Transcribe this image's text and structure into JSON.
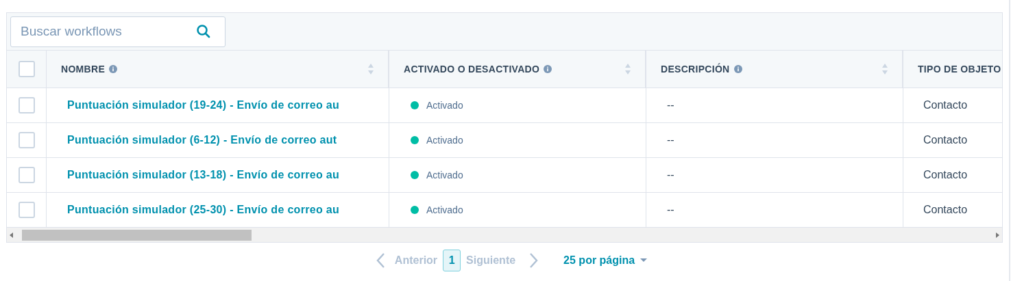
{
  "search": {
    "placeholder": "Buscar workflows"
  },
  "table": {
    "select_all": {
      "checked": false
    },
    "columns": [
      {
        "label": "NOMBRE",
        "info": true,
        "sortable": true
      },
      {
        "label": "ACTIVADO O DESACTIVADO",
        "info": true,
        "sortable": true
      },
      {
        "label": "DESCRIPCIÓN",
        "info": true,
        "sortable": true
      },
      {
        "label": "TIPO DE OBJETO"
      }
    ],
    "rows": [
      {
        "checked": false,
        "name": "Puntuación simulador (19-24) - Envío de correo au",
        "status": "Activado",
        "color": "#00bda5",
        "description": "--",
        "object_type": "Contacto"
      },
      {
        "checked": false,
        "name": "Puntuación simulador (6-12) - Envío de correo aut",
        "status": "Activado",
        "color": "#00bda5",
        "description": "--",
        "object_type": "Contacto"
      },
      {
        "checked": false,
        "name": "Puntuación simulador (13-18) - Envío de correo au",
        "status": "Activado",
        "color": "#00bda5",
        "description": "--",
        "object_type": "Contacto"
      },
      {
        "checked": false,
        "name": "Puntuación simulador (25-30) - Envío de correo au",
        "status": "Activado",
        "color": "#00bda5",
        "description": "--",
        "object_type": "Contacto"
      }
    ]
  },
  "pagination": {
    "previous": "Anterior",
    "pages": [
      {
        "label": "1",
        "selected": true
      }
    ],
    "next": "Siguiente",
    "per_page": "25 por página"
  }
}
